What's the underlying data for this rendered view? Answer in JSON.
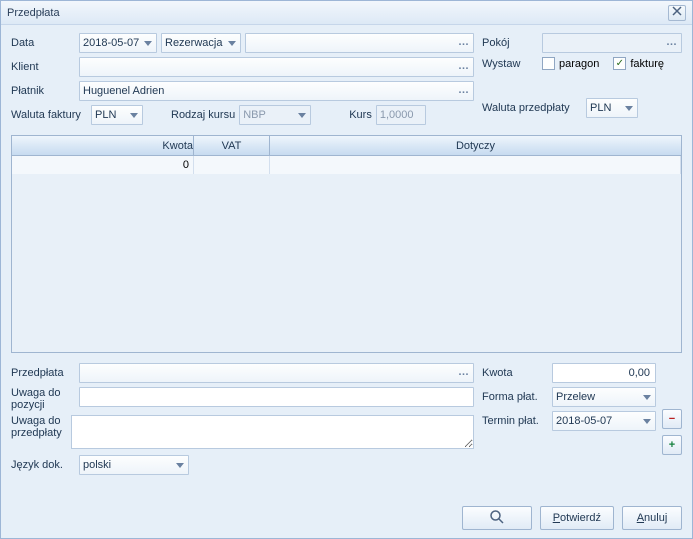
{
  "window": {
    "title": "Przedpłata"
  },
  "form": {
    "data_label": "Data",
    "data_value": "2018-05-07",
    "rezerwacja_label": "Rezerwacja",
    "source_value": "",
    "pokoj_label": "Pokój",
    "pokoj_value": "",
    "klient_label": "Klient",
    "klient_value": "",
    "wystaw_label": "Wystaw",
    "cb_paragon": "paragon",
    "cb_faktura": "fakturę",
    "cb_paragon_checked": false,
    "cb_faktura_checked": true,
    "platnik_label": "Płatnik",
    "platnik_value": "Huguenel Adrien",
    "waluta_faktury_label": "Waluta faktury",
    "waluta_faktury_value": "PLN",
    "rodzaj_kursu_label": "Rodzaj kursu",
    "rodzaj_kursu_value": "NBP",
    "kurs_label": "Kurs",
    "kurs_value": "1,0000",
    "waluta_przedplaty_label": "Waluta przedpłaty",
    "waluta_przedplaty_value": "PLN"
  },
  "grid": {
    "col_kwota": "Kwota",
    "col_vat": "VAT",
    "col_dotyczy": "Dotyczy",
    "rows": [
      {
        "kwota": "0",
        "vat": "",
        "dotyczy": ""
      }
    ]
  },
  "bottom": {
    "przedplata_label": "Przedpłata",
    "przedplata_value": "",
    "uwaga_poz_label": "Uwaga do pozycji",
    "uwaga_przed_label": "Uwaga do przedpłaty",
    "jezyk_label": "Język dok.",
    "jezyk_value": "polski",
    "kwota_label": "Kwota",
    "kwota_value": "0,00",
    "forma_label": "Forma płat.",
    "forma_value": "Przelew",
    "termin_label": "Termin płat.",
    "termin_value": "2018-05-07"
  },
  "buttons": {
    "potwierdz": "Potwierdź",
    "anuluj": "Anuluj"
  }
}
